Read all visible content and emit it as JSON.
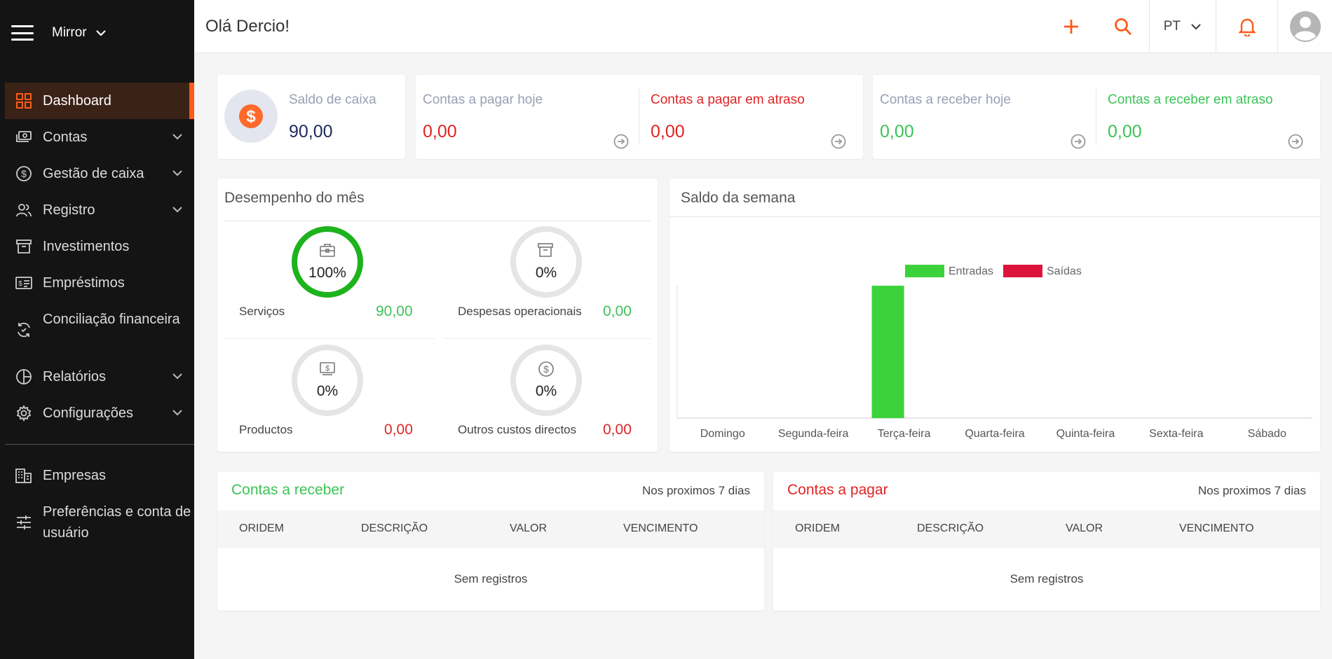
{
  "sidebar": {
    "company": "Mirror",
    "items": [
      {
        "label": "Dashboard"
      },
      {
        "label": "Contas"
      },
      {
        "label": "Gestão de caixa"
      },
      {
        "label": "Registro"
      },
      {
        "label": "Investimentos"
      },
      {
        "label": "Empréstimos"
      },
      {
        "label": "Conciliação financeira"
      },
      {
        "label": "Relatórios"
      },
      {
        "label": "Configurações"
      },
      {
        "label": "Empresas"
      },
      {
        "label": "Preferências e conta de usuário"
      }
    ]
  },
  "header": {
    "greeting": "Olá Dercio!",
    "language": "PT"
  },
  "summary": {
    "saldo_caixa": {
      "label": "Saldo de caixa",
      "value": "90,00"
    },
    "pagar_hoje": {
      "label": "Contas a pagar hoje",
      "value": "0,00"
    },
    "pagar_atraso": {
      "label": "Contas a pagar em atraso",
      "value": "0,00"
    },
    "receber_hoje": {
      "label": "Contas a receber hoje",
      "value": "0,00"
    },
    "receber_atraso": {
      "label": "Contas a receber em atraso",
      "value": "0,00"
    }
  },
  "desempenho": {
    "title": "Desempenho do mês",
    "metrics": [
      {
        "label": "Serviços",
        "value": "90,00",
        "percent_text": "100%",
        "percent": 100
      },
      {
        "label": "Despesas operacionais",
        "value": "0,00",
        "percent_text": "0%",
        "percent": 0
      },
      {
        "label": "Productos",
        "value": "0,00",
        "percent_text": "0%",
        "percent": 0
      },
      {
        "label": "Outros custos directos",
        "value": "0,00",
        "percent_text": "0%",
        "percent": 0
      }
    ]
  },
  "chart_data": {
    "type": "bar",
    "title": "Saldo da semana",
    "categories": [
      "Domingo",
      "Segunda-feira",
      "Terça-feira",
      "Quarta-feira",
      "Quinta-feira",
      "Sexta-feira",
      "Sábado"
    ],
    "series": [
      {
        "name": "Entradas",
        "values": [
          0,
          0,
          90,
          0,
          0,
          0,
          0
        ],
        "color": "#3cd23c"
      },
      {
        "name": "Saídas",
        "values": [
          0,
          0,
          0,
          0,
          0,
          0,
          0
        ],
        "color": "#dc143c"
      }
    ],
    "ylim": [
      0,
      90
    ],
    "legend": "top-center",
    "grid": false
  },
  "receber": {
    "title": "Contas a receber",
    "subtitle": "Nos proximos 7 dias",
    "columns": [
      "ORIDEM",
      "DESCRIÇÃO",
      "VALOR",
      "VENCIMENTO"
    ],
    "empty": "Sem registros"
  },
  "pagar": {
    "title": "Contas a pagar",
    "subtitle": "Nos proximos 7 dias",
    "columns": [
      "ORIDEM",
      "DESCRIÇÃO",
      "VALOR",
      "VENCIMENTO"
    ],
    "empty": "Sem registros"
  },
  "colors": {
    "accent": "#ff5a1a",
    "green": "#3cc356",
    "red": "#e02424",
    "navy": "#1f2a5c"
  }
}
